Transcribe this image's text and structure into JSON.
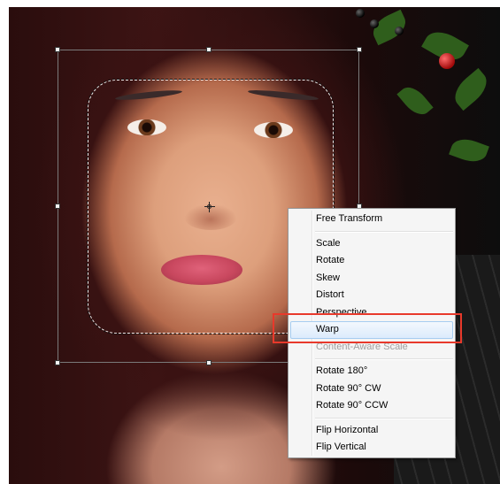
{
  "menu": {
    "items": [
      {
        "label": "Free Transform",
        "state": "normal"
      },
      {
        "separator": true
      },
      {
        "label": "Scale",
        "state": "normal"
      },
      {
        "label": "Rotate",
        "state": "normal"
      },
      {
        "label": "Skew",
        "state": "normal"
      },
      {
        "label": "Distort",
        "state": "normal"
      },
      {
        "label": "Perspective",
        "state": "normal"
      },
      {
        "label": "Warp",
        "state": "highlighted"
      },
      {
        "label": "Content-Aware Scale",
        "state": "disabled"
      },
      {
        "separator": true
      },
      {
        "label": "Rotate 180°",
        "state": "normal"
      },
      {
        "label": "Rotate 90° CW",
        "state": "normal"
      },
      {
        "label": "Rotate 90° CCW",
        "state": "normal"
      },
      {
        "separator": true
      },
      {
        "label": "Flip Horizontal",
        "state": "normal"
      },
      {
        "label": "Flip Vertical",
        "state": "normal"
      }
    ]
  },
  "colors": {
    "highlight_box": "#e8392b",
    "menu_background": "#f5f5f5",
    "disabled_text": "#a0a0a0"
  }
}
